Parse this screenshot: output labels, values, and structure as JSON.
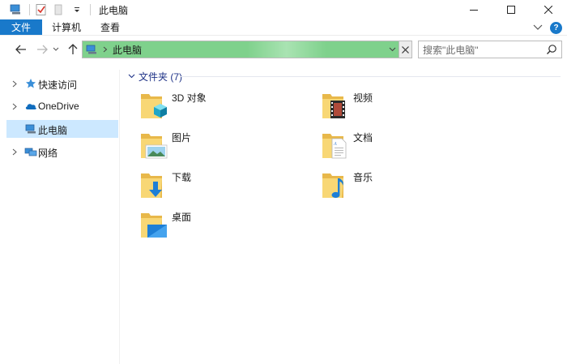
{
  "window": {
    "title": "此电脑"
  },
  "ribbon": {
    "tabs": [
      "文件",
      "计算机",
      "查看"
    ],
    "help_label": "?"
  },
  "address_bar": {
    "current": "此电脑",
    "search_placeholder": "搜索\"此电脑\""
  },
  "sidebar": {
    "items": [
      {
        "label": "快速访问",
        "icon": "star-pin-icon",
        "has_arrow": true,
        "selected": false
      },
      {
        "label": "OneDrive",
        "icon": "cloud-icon",
        "has_arrow": true,
        "selected": false
      },
      {
        "label": "此电脑",
        "icon": "computer-icon",
        "has_arrow": false,
        "selected": true
      },
      {
        "label": "网络",
        "icon": "network-icon",
        "has_arrow": true,
        "selected": false
      }
    ]
  },
  "content": {
    "group_label": "文件夹 (7)",
    "folders": [
      {
        "label": "3D 对象",
        "overlay": "cube-3d-icon"
      },
      {
        "label": "视频",
        "overlay": "film-icon"
      },
      {
        "label": "图片",
        "overlay": "picture-icon"
      },
      {
        "label": "文档",
        "overlay": "document-icon"
      },
      {
        "label": "下载",
        "overlay": "download-arrow-icon"
      },
      {
        "label": "音乐",
        "overlay": "music-note-icon"
      },
      {
        "label": "桌面",
        "overlay": "desktop-icon"
      }
    ]
  },
  "colors": {
    "accent": "#1979ca",
    "selection": "#cce8ff",
    "address_fill": "#7fd18c",
    "group_header": "#1e3287",
    "folder_yellow": "#f8d775"
  }
}
